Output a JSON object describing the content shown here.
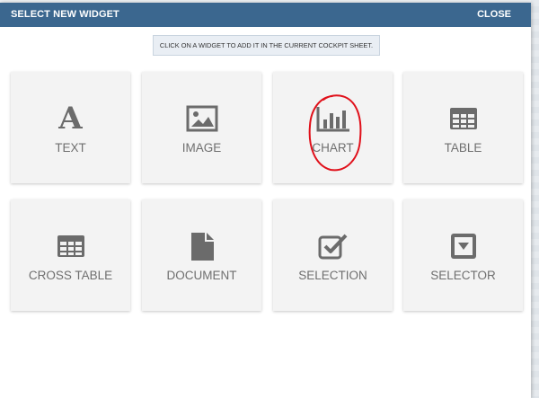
{
  "dialog": {
    "title": "SELECT NEW WIDGET",
    "close_label": "CLOSE",
    "hint": "CLICK ON A WIDGET TO ADD IT IN THE CURRENT COCKPIT SHEET."
  },
  "widgets": [
    {
      "label": "TEXT",
      "icon": "text-icon"
    },
    {
      "label": "IMAGE",
      "icon": "image-icon"
    },
    {
      "label": "CHART",
      "icon": "chart-icon"
    },
    {
      "label": "TABLE",
      "icon": "table-icon"
    },
    {
      "label": "CROSS TABLE",
      "icon": "cross-table-icon"
    },
    {
      "label": "DOCUMENT",
      "icon": "document-icon"
    },
    {
      "label": "SELECTION",
      "icon": "selection-icon"
    },
    {
      "label": "SELECTOR",
      "icon": "selector-icon"
    }
  ],
  "colors": {
    "toolbar": "#3b678f",
    "tile_background": "#f3f3f3",
    "icon": "#6b6b6b",
    "annotation": "#e0101a"
  },
  "annotation": {
    "target": "CHART",
    "shape": "hand-drawn red circle"
  }
}
